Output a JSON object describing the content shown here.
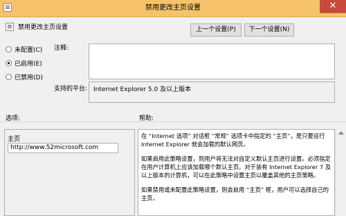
{
  "window": {
    "title": "禁用更改主页设置",
    "close_glyph": "✕"
  },
  "header": {
    "title": "禁用更改主页设置"
  },
  "nav": {
    "prev_label": "上一个设置(P)",
    "next_label": "下一个设置(N)"
  },
  "state": {
    "options": [
      "未配置(C)",
      "已启用(E)",
      "已禁用(D)"
    ],
    "selected": "已启用(E)"
  },
  "comment": {
    "label": "注释:",
    "value": ""
  },
  "platform": {
    "label": "支持的平台:",
    "value": "Internet Explorer 5.0 及以上版本"
  },
  "options_section": {
    "label": "选项:",
    "home_label": "主页",
    "home_value": "http://www.52microsoft.com"
  },
  "help_section": {
    "label": "帮助:",
    "paragraphs": [
      "在 “Internet 选项” 对话框 “常规” 选项卡中指定的 “主页”，是只要运行 Internet Explorer 就会加载的默认网页。",
      "如果启用此策略设置，则用户将无法对自定义默认主页进行设置。必须指定在用户计算机上应该加载哪个默认主页。对于装有 Internet Explorer 7 及以上版本的计算机，可以在此策略中设置主页以覆盖其他的主页策略。",
      "如果禁用或未配置此策略设置，则会启用 “主页” 框，用户可以选择自己的主页。"
    ]
  }
}
